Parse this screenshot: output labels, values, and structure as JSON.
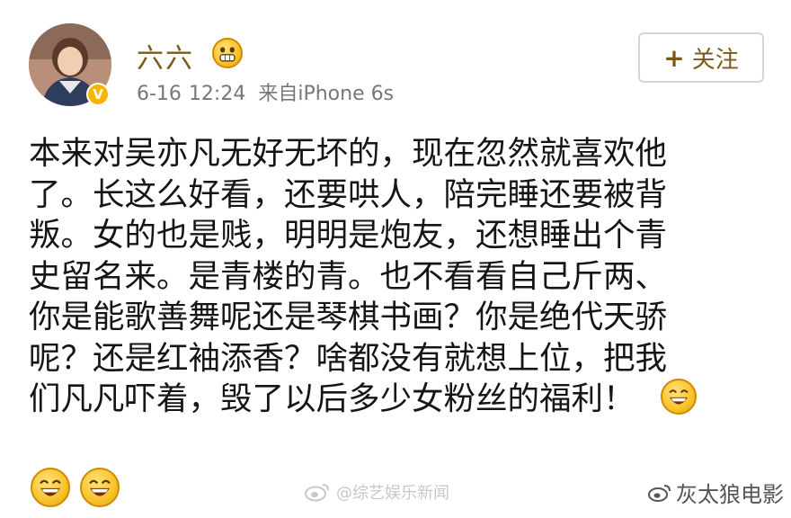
{
  "post": {
    "username": "六六",
    "date": "6-16",
    "time": "12:24",
    "source": "来自iPhone 6s",
    "follow_label": "关注",
    "follow_plus": "+",
    "verified_badge": "V",
    "content_lines": [
      "本来对吴亦凡无好无坏的，现在忽然就喜欢他",
      "了。长这么好看，还要哄人，陪完睡还要被背",
      "叛。女的也是贱，明明是炮友，还想睡出个青",
      "史留名来。是青楼的青。也不看看自己斤两、",
      "你是能歌善舞呢还是琴棋书画？你是绝代天骄",
      "呢？还是红袖添香？啥都没有就想上位，把我",
      "们凡凡吓着，毁了以后多少女粉丝的福利！"
    ],
    "emojis": {
      "name_badge": "grimace-emoji-icon",
      "inline": "laughing-emoji-icon",
      "bottom": [
        "laughing-emoji-icon",
        "laughing-emoji-icon"
      ]
    }
  },
  "watermarks": {
    "middle": "@综艺娱乐新闻",
    "right": "灰太狼电影"
  },
  "colors": {
    "username": "#7a5a16",
    "meta": "#777777",
    "content": "#151515",
    "emoji_fill": "#f8c22a",
    "verified": "#f7b500"
  }
}
